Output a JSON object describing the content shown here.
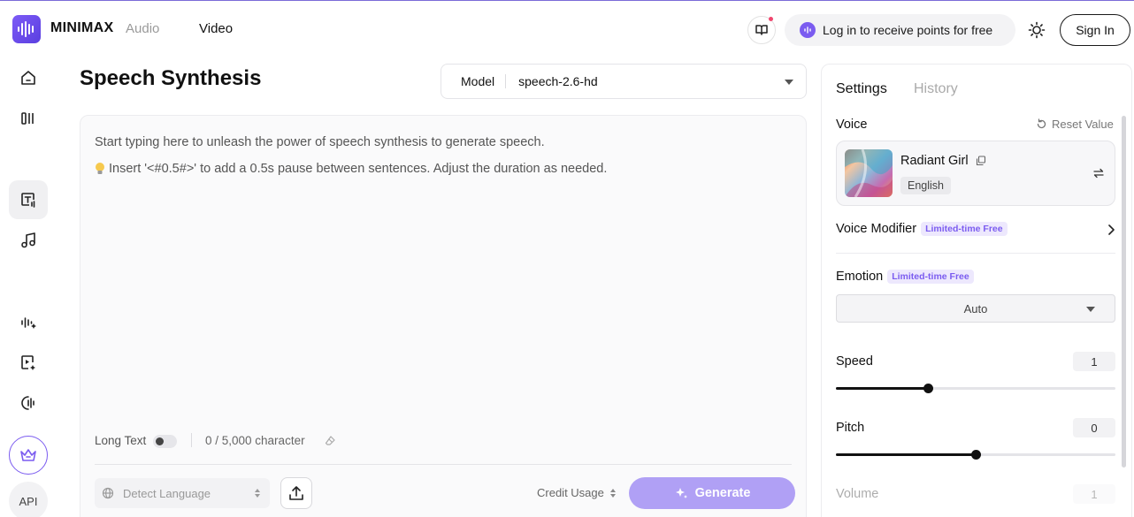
{
  "header": {
    "brand": "MINIMAX",
    "nav": [
      {
        "label": "Audio"
      },
      {
        "label": "Video"
      }
    ],
    "points_cta": "Log in to receive points for free",
    "sign_in": "Sign In"
  },
  "sidebar": {
    "items": [
      {
        "icon": "home-icon"
      },
      {
        "icon": "library-icon"
      },
      {
        "icon": "text-to-speech-icon",
        "active": true
      },
      {
        "icon": "music-icon"
      },
      {
        "icon": "voice-design-icon"
      },
      {
        "icon": "video-icon"
      },
      {
        "icon": "voice-clone-icon"
      }
    ],
    "crown": "crown-icon",
    "api_label": "API"
  },
  "main": {
    "title": "Speech Synthesis",
    "model": {
      "label": "Model",
      "value": "speech-2.6-hd"
    },
    "editor": {
      "placeholder_line1": "Start typing here to unleash the power of speech synthesis to generate speech.",
      "placeholder_line2": "Insert '<#0.5#>' to add a 0.5s pause between sentences. Adjust the duration as needed."
    },
    "long_text_label": "Long Text",
    "long_text_enabled": false,
    "char_count": "0 / 5,000 character",
    "detect_language": "Detect Language",
    "credit_usage": "Credit Usage",
    "generate": "Generate"
  },
  "panel": {
    "tabs": [
      {
        "label": "Settings",
        "active": true
      },
      {
        "label": "History",
        "active": false
      }
    ],
    "voice_label": "Voice",
    "reset_label": "Reset Value",
    "voice": {
      "name": "Radiant Girl",
      "language": "English"
    },
    "voice_modifier": {
      "label": "Voice Modifier",
      "badge": "Limited-time Free"
    },
    "emotion": {
      "label": "Emotion",
      "badge": "Limited-time Free",
      "value": "Auto"
    },
    "speed": {
      "label": "Speed",
      "value": "1",
      "fraction": 0.33
    },
    "pitch": {
      "label": "Pitch",
      "value": "0",
      "fraction": 0.5
    },
    "volume": {
      "label": "Volume",
      "value": "1"
    }
  },
  "colors": {
    "accent": "#7b5cf0",
    "generate_bg": "#b0a0f5",
    "badge_bg": "#ede8fd"
  }
}
